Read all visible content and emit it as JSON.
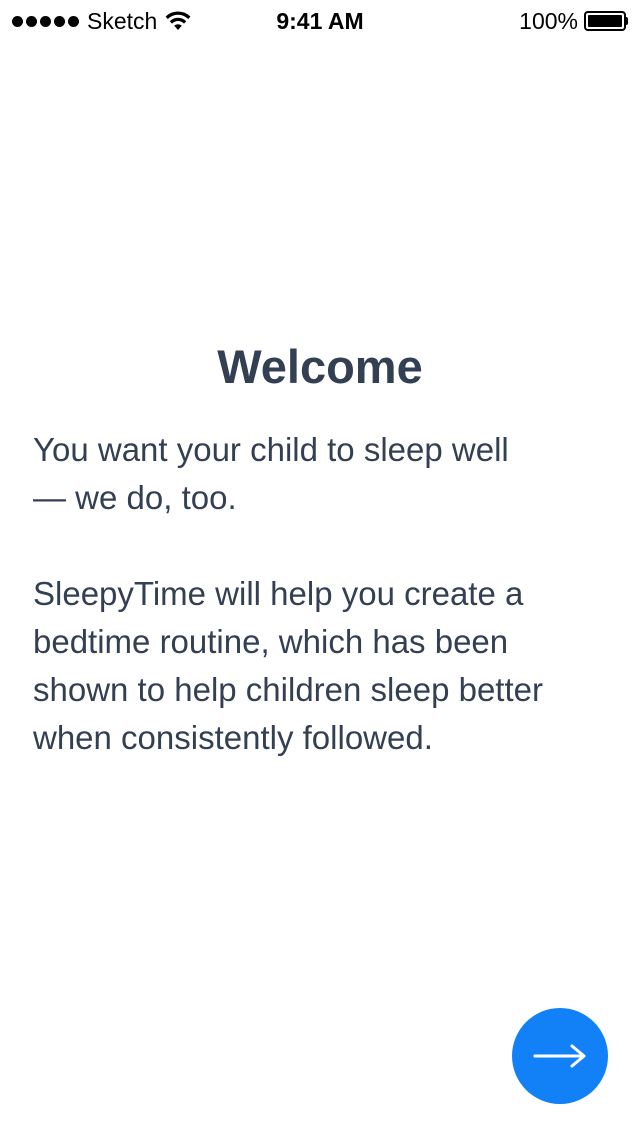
{
  "status_bar": {
    "carrier": "Sketch",
    "time": "9:41 AM",
    "battery_percent": "100%",
    "battery_level": 1.0,
    "signal_bars": 5,
    "icons": [
      "signal-dots-icon",
      "wifi-icon",
      "battery-icon"
    ]
  },
  "welcome": {
    "title": "Welcome",
    "paragraph1_lines": [
      "You want your child to sleep well",
      "— we do, too."
    ],
    "paragraph2_lines": [
      "SleepyTime will help you create a",
      "bedtime routine, which has been",
      "shown to help children sleep better",
      "when consistently followed."
    ]
  },
  "next_button": {
    "icon": "arrow-right-icon",
    "color": "#1281f7"
  },
  "colors": {
    "text": "#333f52",
    "accent": "#1281f7",
    "background": "#ffffff"
  }
}
